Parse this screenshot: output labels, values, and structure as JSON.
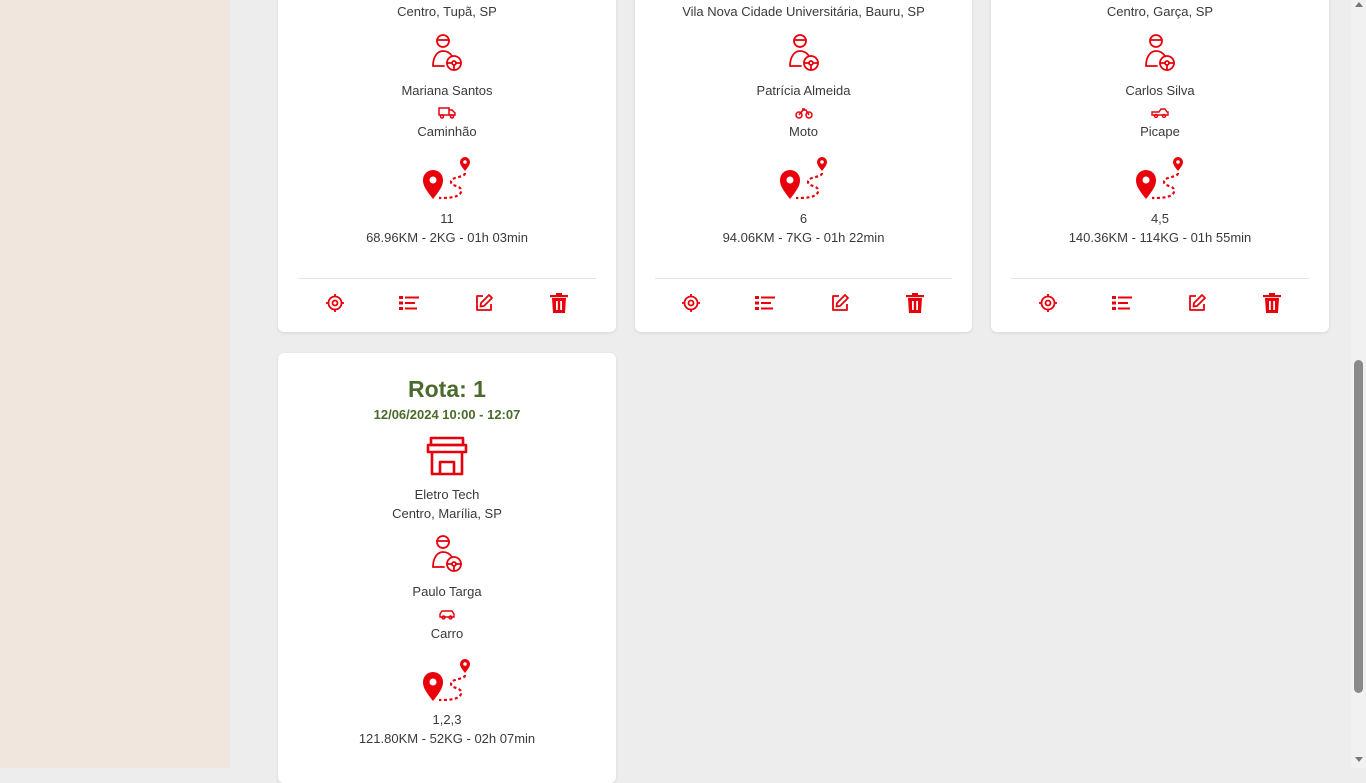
{
  "accent_color": "#e8000b",
  "title_color": "#4a6b2b",
  "cards": [
    {
      "address": "Centro, Tupã, SP",
      "driver": "Mariana Santos",
      "vehicle_icon": "truck-icon",
      "vehicle": "Caminhão",
      "orders": "11",
      "summary": "68.96KM - 2KG - 01h 03min"
    },
    {
      "address": "Vila Nova Cidade Universitária, Bauru, SP",
      "driver": "Patrícia Almeida",
      "vehicle_icon": "motorcycle-icon",
      "vehicle": "Moto",
      "orders": "6",
      "summary": "94.06KM - 7KG - 01h 22min"
    },
    {
      "address": "Centro, Garça, SP",
      "driver": "Carlos Silva",
      "vehicle_icon": "pickup-icon",
      "vehicle": "Picape",
      "orders": "4,5",
      "summary": "140.36KM - 114KG - 01h 55min"
    },
    {
      "title": "Rota: 1",
      "datetime": "12/06/2024 10:00 - 12:07",
      "store": "Eletro Tech",
      "address": "Centro, Marília, SP",
      "driver": "Paulo Targa",
      "vehicle_icon": "car-icon",
      "vehicle": "Carro",
      "orders": "1,2,3",
      "summary": "121.80KM - 52KG - 02h 07min"
    }
  ],
  "actions": [
    "locate-icon",
    "list-icon",
    "edit-icon",
    "trash-icon"
  ]
}
